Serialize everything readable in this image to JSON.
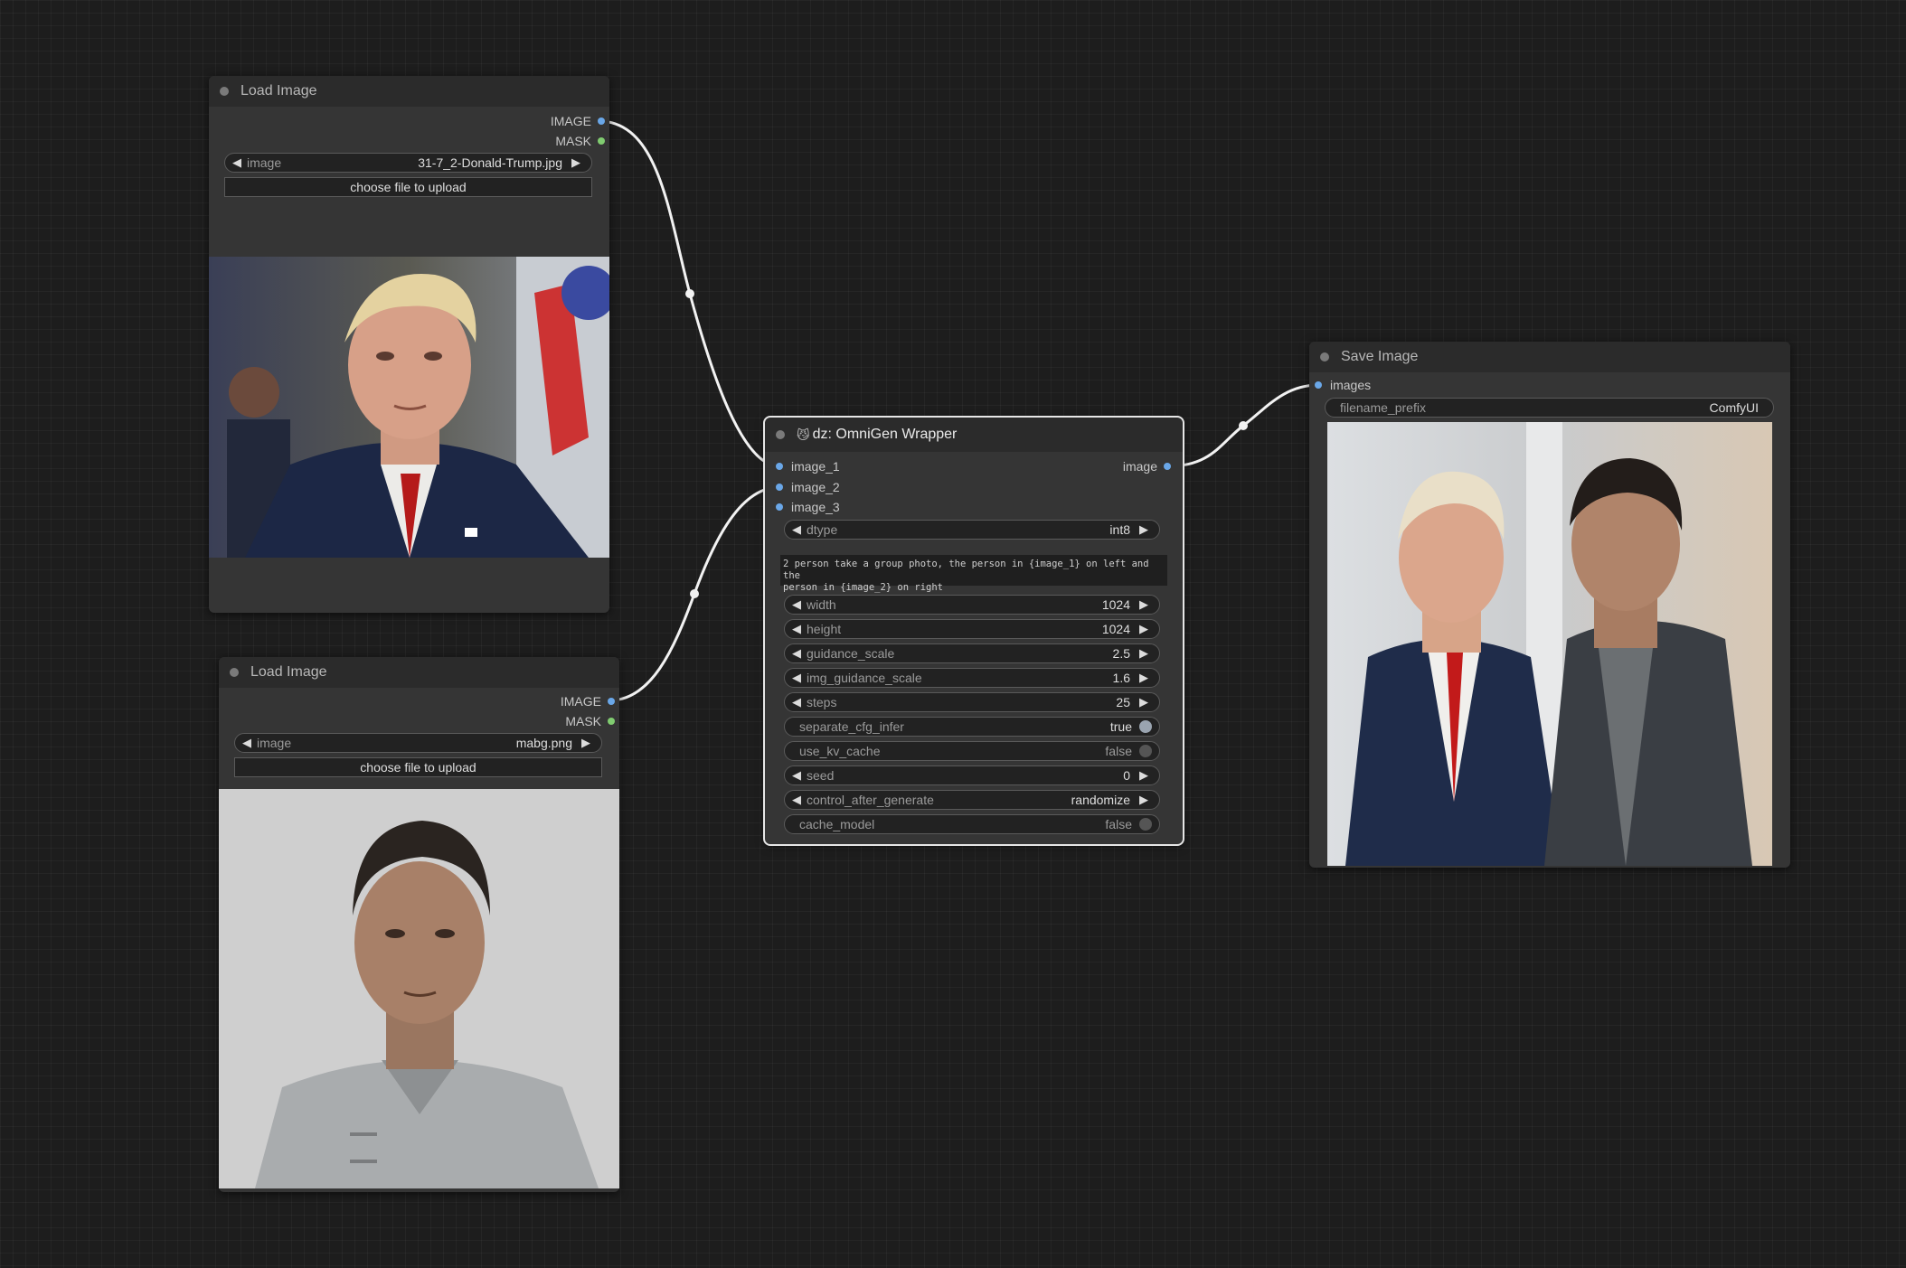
{
  "nodes": {
    "load_image_1": {
      "title": "Load Image",
      "outputs": [
        "IMAGE",
        "MASK"
      ],
      "image_widget": {
        "label": "image",
        "value": "31-7_2-Donald-Trump.jpg"
      },
      "upload_label": "choose file to upload"
    },
    "load_image_2": {
      "title": "Load Image",
      "outputs": [
        "IMAGE",
        "MASK"
      ],
      "image_widget": {
        "label": "image",
        "value": "mabg.png"
      },
      "upload_label": "choose file to upload"
    },
    "omnigen": {
      "title_emoji": "😼",
      "title": "dz: OmniGen Wrapper",
      "inputs": [
        "image_1",
        "image_2",
        "image_3"
      ],
      "output": "image",
      "dtype": {
        "label": "dtype",
        "value": "int8"
      },
      "prompt_line1": "2 person take a group photo, the person in {image_1} on left and the",
      "prompt_line2": "person in {image_2} on right",
      "width": {
        "label": "width",
        "value": "1024"
      },
      "height": {
        "label": "height",
        "value": "1024"
      },
      "guidance_scale": {
        "label": "guidance_scale",
        "value": "2.5"
      },
      "img_guidance_scale": {
        "label": "img_guidance_scale",
        "value": "1.6"
      },
      "steps": {
        "label": "steps",
        "value": "25"
      },
      "separate_cfg_infer": {
        "label": "separate_cfg_infer",
        "value": "true"
      },
      "use_kv_cache": {
        "label": "use_kv_cache",
        "value": "false"
      },
      "seed": {
        "label": "seed",
        "value": "0"
      },
      "control_after_generate": {
        "label": "control_after_generate",
        "value": "randomize"
      },
      "cache_model": {
        "label": "cache_model",
        "value": "false"
      }
    },
    "save_image": {
      "title": "Save Image",
      "input": "images",
      "filename_prefix": {
        "label": "filename_prefix",
        "value": "ComfyUI"
      }
    }
  },
  "colors": {
    "canvas_bg": "#1d1d1d",
    "node_body": "#353535",
    "node_title": "#2b2b2b",
    "image_slot": "#6aa7e8",
    "mask_slot": "#80cc70",
    "link": "#f2f2f2"
  },
  "icons": {
    "node_collapse": "title-dot-icon",
    "combo_left": "triangle-left-icon",
    "combo_right": "triangle-right-icon"
  }
}
